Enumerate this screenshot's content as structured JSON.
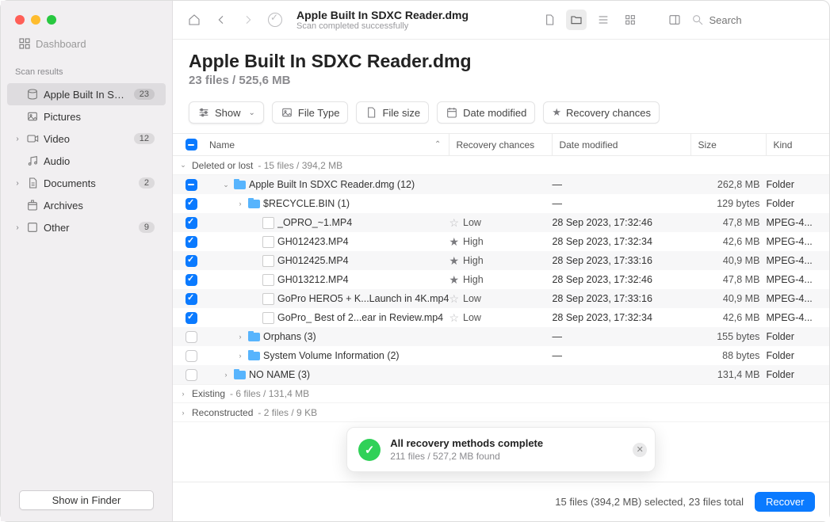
{
  "sidebar": {
    "dashboard_label": "Dashboard",
    "scan_results_label": "Scan results",
    "items": [
      {
        "label": "Apple Built In SDX...",
        "badge": "23",
        "icon": "disk",
        "selected": true
      },
      {
        "label": "Pictures",
        "icon": "picture"
      },
      {
        "label": "Video",
        "badge": "12",
        "icon": "video",
        "caret": true
      },
      {
        "label": "Audio",
        "icon": "audio"
      },
      {
        "label": "Documents",
        "badge": "2",
        "icon": "document",
        "caret": true
      },
      {
        "label": "Archives",
        "icon": "archive"
      },
      {
        "label": "Other",
        "badge": "9",
        "icon": "other",
        "caret": true
      }
    ],
    "show_in_finder": "Show in Finder"
  },
  "toolbar": {
    "title": "Apple Built In SDXC Reader.dmg",
    "subtitle": "Scan completed successfully",
    "search_placeholder": "Search"
  },
  "header": {
    "title": "Apple Built In SDXC Reader.dmg",
    "subtitle": "23 files / 525,6 MB"
  },
  "chips": {
    "show": "Show",
    "file_type": "File Type",
    "file_size": "File size",
    "date_modified": "Date modified",
    "recovery_chances": "Recovery chances"
  },
  "columns": {
    "name": "Name",
    "recovery": "Recovery chances",
    "modified": "Date modified",
    "size": "Size",
    "kind": "Kind"
  },
  "groups": {
    "deleted_label": "Deleted or lost",
    "deleted_meta": "- 15 files / 394,2 MB",
    "existing_label": "Existing",
    "existing_meta": "- 6 files / 131,4 MB",
    "reconstructed_label": "Reconstructed",
    "reconstructed_meta": "- 2 files / 9 KB"
  },
  "rows": [
    {
      "cb": "indet",
      "indent": 0,
      "caret": "down",
      "icon": "folder",
      "name": "Apple Built In SDXC Reader.dmg (12)",
      "rc": "",
      "dm": "—",
      "sz": "262,8 MB",
      "kd": "Folder"
    },
    {
      "cb": "checked",
      "indent": 1,
      "caret": "right",
      "icon": "folder",
      "name": "$RECYCLE.BIN (1)",
      "rc": "",
      "dm": "—",
      "sz": "129 bytes",
      "kd": "Folder"
    },
    {
      "cb": "checked",
      "indent": 2,
      "icon": "video",
      "name": "_OPRO_~1.MP4",
      "rc": "Low",
      "rc_fill": false,
      "dm": "28 Sep 2023, 17:32:46",
      "sz": "47,8 MB",
      "kd": "MPEG-4..."
    },
    {
      "cb": "checked",
      "indent": 2,
      "icon": "video",
      "name": "GH012423.MP4",
      "rc": "High",
      "rc_fill": true,
      "dm": "28 Sep 2023, 17:32:34",
      "sz": "42,6 MB",
      "kd": "MPEG-4..."
    },
    {
      "cb": "checked",
      "indent": 2,
      "icon": "video",
      "name": "GH012425.MP4",
      "rc": "High",
      "rc_fill": true,
      "dm": "28 Sep 2023, 17:33:16",
      "sz": "40,9 MB",
      "kd": "MPEG-4..."
    },
    {
      "cb": "checked",
      "indent": 2,
      "icon": "video",
      "name": "GH013212.MP4",
      "rc": "High",
      "rc_fill": true,
      "dm": "28 Sep 2023, 17:32:46",
      "sz": "47,8 MB",
      "kd": "MPEG-4..."
    },
    {
      "cb": "checked",
      "indent": 2,
      "icon": "video",
      "name": "GoPro HERO5 + K...Launch in 4K.mp4",
      "rc": "Low",
      "rc_fill": false,
      "dm": "28 Sep 2023, 17:33:16",
      "sz": "40,9 MB",
      "kd": "MPEG-4..."
    },
    {
      "cb": "checked",
      "indent": 2,
      "icon": "video",
      "name": "GoPro_ Best of 2...ear in Review.mp4",
      "rc": "Low",
      "rc_fill": false,
      "dm": "28 Sep 2023, 17:32:34",
      "sz": "42,6 MB",
      "kd": "MPEG-4..."
    },
    {
      "cb": "none",
      "indent": 1,
      "caret": "right",
      "icon": "folder",
      "name": "Orphans (3)",
      "rc": "",
      "dm": "—",
      "sz": "155 bytes",
      "kd": "Folder"
    },
    {
      "cb": "none",
      "indent": 1,
      "caret": "right",
      "icon": "folder",
      "name": "System Volume Information (2)",
      "rc": "",
      "dm": "—",
      "sz": "88 bytes",
      "kd": "Folder"
    },
    {
      "cb": "none",
      "indent": 0,
      "caret": "right",
      "icon": "folder",
      "name": "NO NAME (3)",
      "rc": "",
      "dm": "",
      "sz": "131,4 MB",
      "kd": "Folder"
    }
  ],
  "toast": {
    "title": "All recovery methods complete",
    "subtitle": "211 files / 527,2 MB found"
  },
  "footer": {
    "status": "15 files (394,2 MB) selected, 23 files total",
    "recover": "Recover"
  }
}
